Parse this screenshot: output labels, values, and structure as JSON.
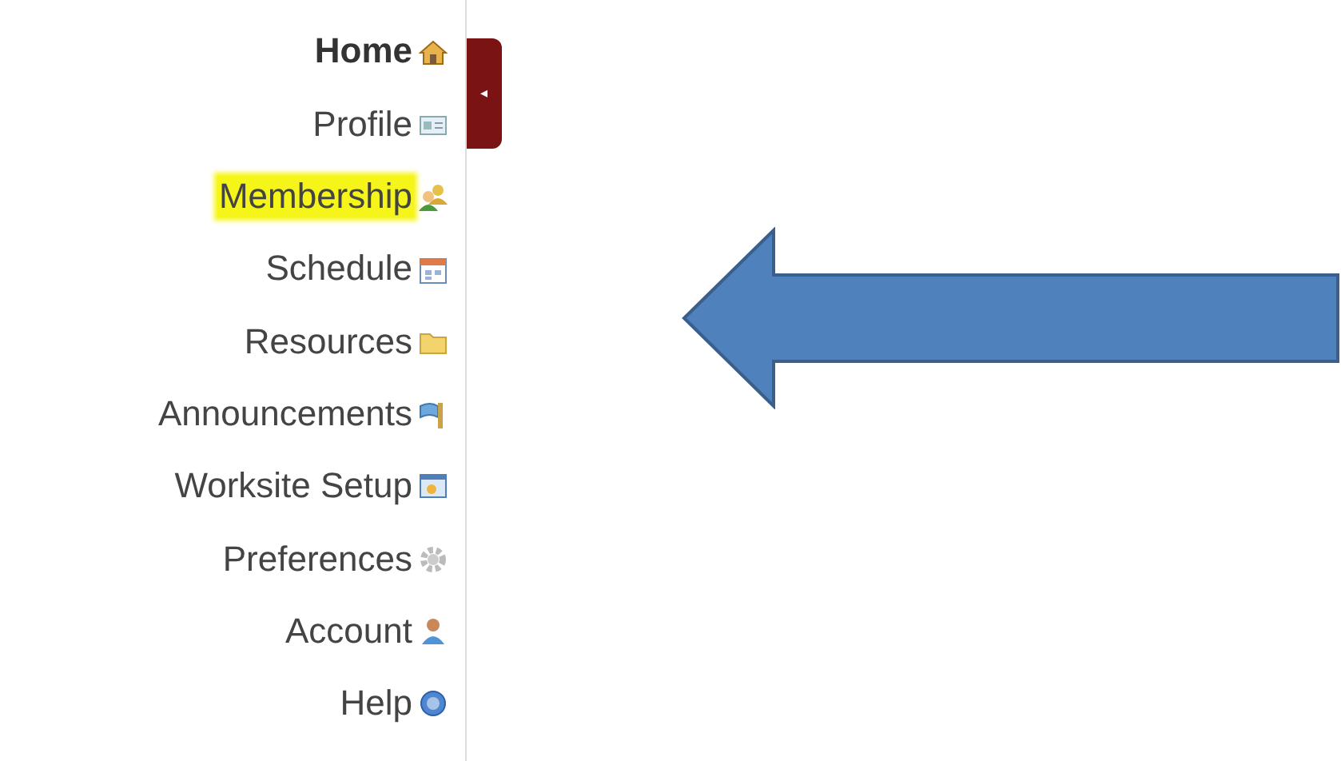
{
  "menu": [
    {
      "label": "Home",
      "selected": true,
      "highlighted": false
    },
    {
      "label": "Profile",
      "selected": false,
      "highlighted": false
    },
    {
      "label": "Membership",
      "selected": false,
      "highlighted": true
    },
    {
      "label": "Schedule",
      "selected": false,
      "highlighted": false
    },
    {
      "label": "Resources",
      "selected": false,
      "highlighted": false
    },
    {
      "label": "Announcements",
      "selected": false,
      "highlighted": false
    },
    {
      "label": "Worksite Setup",
      "selected": false,
      "highlighted": false
    },
    {
      "label": "Preferences",
      "selected": false,
      "highlighted": false
    },
    {
      "label": "Account",
      "selected": false,
      "highlighted": false
    },
    {
      "label": "Help",
      "selected": false,
      "highlighted": false
    }
  ],
  "collapse_tab": {
    "glyph": "◂"
  }
}
